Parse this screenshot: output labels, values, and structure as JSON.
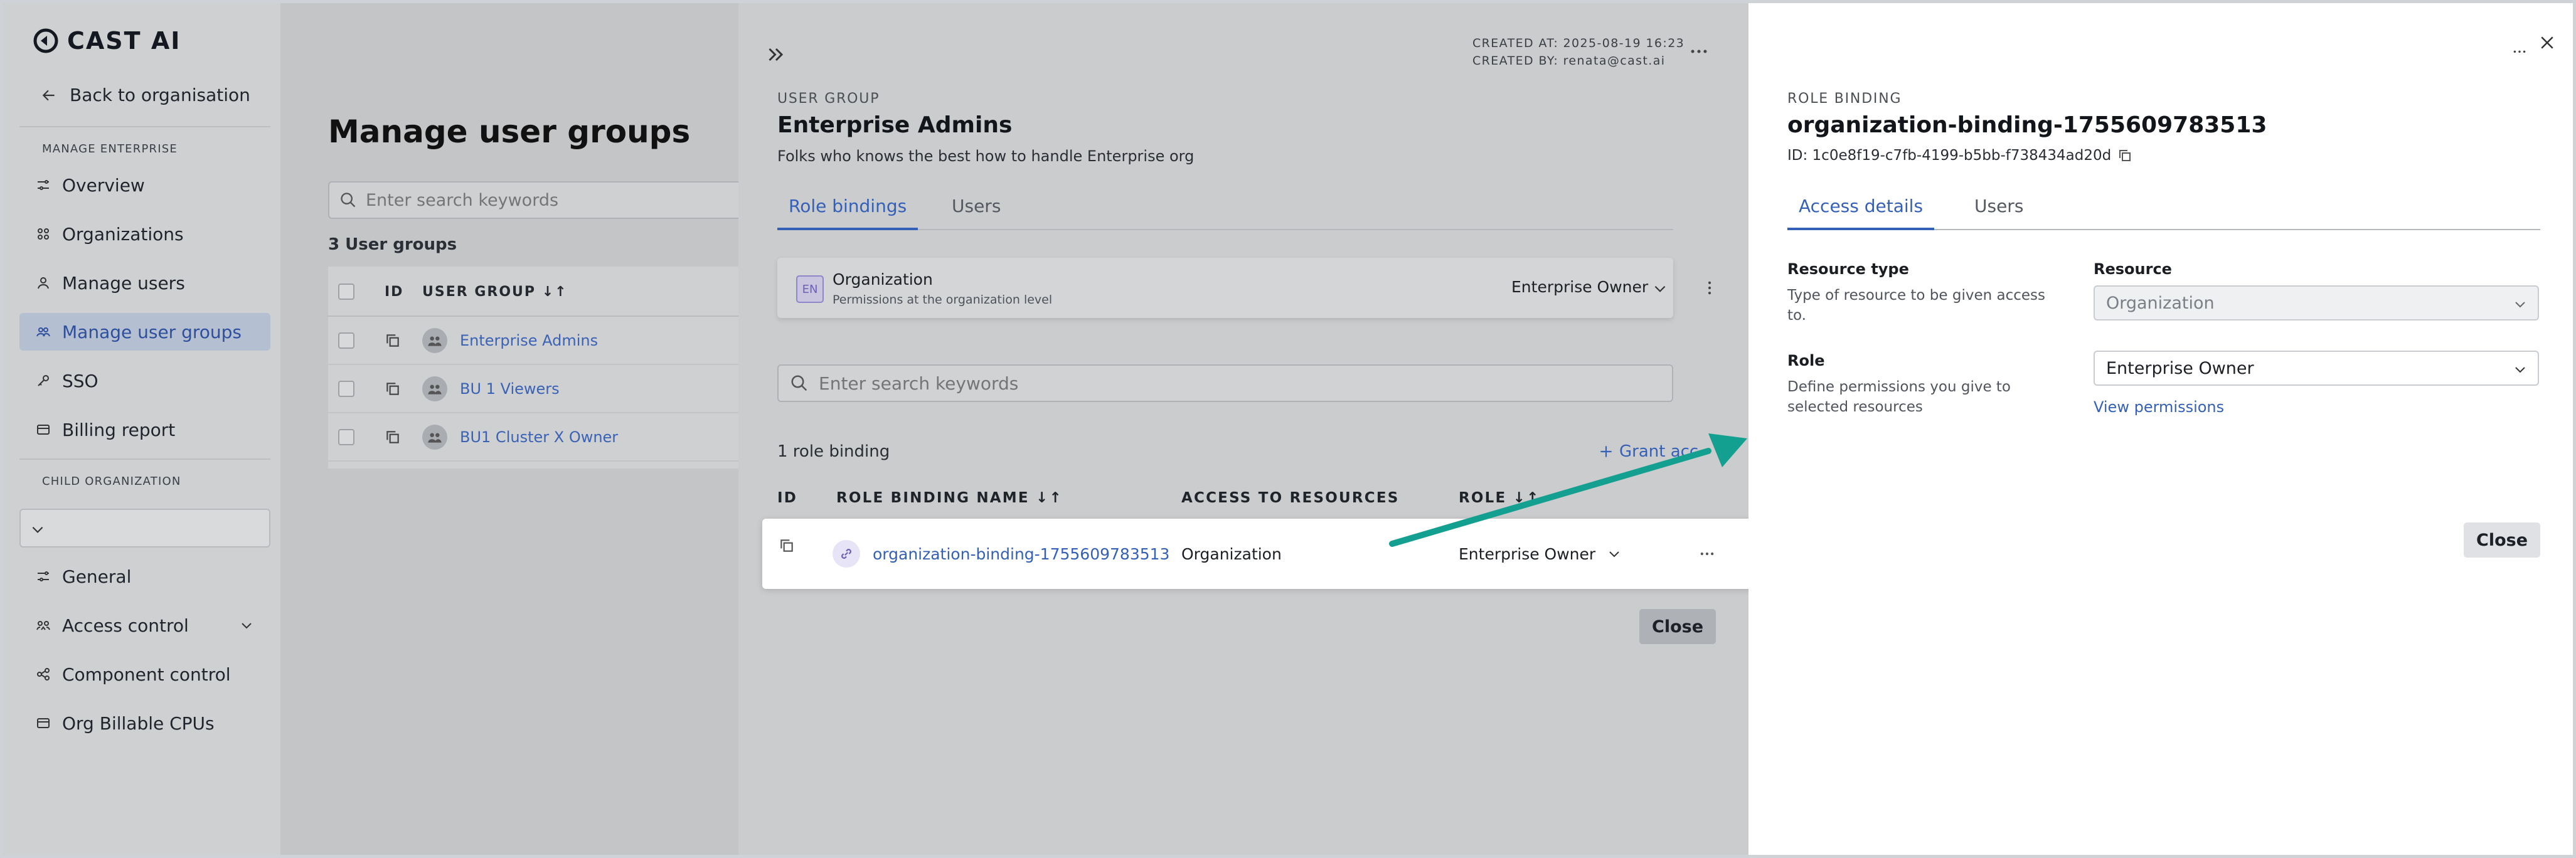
{
  "sidebar": {
    "logo": "CAST AI",
    "back": "Back to organisation",
    "section_manage": "MANAGE ENTERPRISE",
    "manage_items": [
      "Overview",
      "Organizations",
      "Manage users",
      "Manage user groups",
      "SSO",
      "Billing report"
    ],
    "active_item": "Manage user groups",
    "section_child": "CHILD ORGANIZATION",
    "child_items": [
      "General",
      "Access control",
      "Component control",
      "Org Billable CPUs"
    ]
  },
  "main": {
    "title": "Manage user groups",
    "search_placeholder": "Enter search keywords",
    "count": "3 User groups",
    "col_id": "ID",
    "col_group": "USER GROUP",
    "groups": [
      "Enterprise Admins",
      "BU 1 Viewers",
      "BU1 Cluster X Owner"
    ]
  },
  "group_panel": {
    "created_at": "CREATED AT: 2025-08-19 16:23",
    "created_by": "CREATED BY: renata@cast.ai",
    "eyebrow": "USER GROUP",
    "title": "Enterprise Admins",
    "description": "Folks who knows the best how to handle Enterprise org",
    "tabs": [
      "Role bindings",
      "Users"
    ],
    "active_tab": "Role bindings",
    "org_card": {
      "badge": "EN",
      "title": "Organization",
      "subtitle": "Permissions at the organization level",
      "role": "Enterprise Owner"
    },
    "search_placeholder": "Enter search keywords",
    "count": "1 role binding",
    "grant_label": "Grant acc",
    "columns": {
      "id": "ID",
      "name": "ROLE BINDING NAME",
      "access": "ACCESS TO RESOURCES",
      "role": "ROLE"
    },
    "row": {
      "name": "organization-binding-1755609783513",
      "resource": "Organization",
      "role": "Enterprise Owner"
    },
    "close_label": "Close"
  },
  "role_binding_panel": {
    "eyebrow": "ROLE BINDING",
    "title": "organization-binding-1755609783513",
    "id": "ID: 1c0e8f19-c7fb-4199-b5bb-f738434ad20d",
    "tabs": [
      "Access details",
      "Users"
    ],
    "active_tab": "Access details",
    "resource_type_label": "Resource type",
    "resource_type_help": "Type of resource to be given access to.",
    "resource_label": "Resource",
    "resource_value": "Organization",
    "role_label": "Role",
    "role_help": "Define permissions you give to selected resources",
    "role_value": "Enterprise Owner",
    "view_permissions": "View permissions",
    "close_label": "Close"
  },
  "colors": {
    "accent": "#3560b8",
    "annotation_arrow": "#14a090"
  }
}
